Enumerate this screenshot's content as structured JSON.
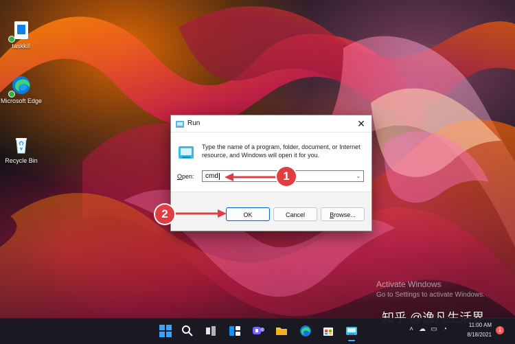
{
  "desktop": {
    "icons": [
      {
        "label": "taskkill"
      },
      {
        "label": "Microsoft Edge"
      },
      {
        "label": "Recycle Bin"
      }
    ]
  },
  "run_dialog": {
    "title": "Run",
    "description": "Type the name of a program, folder, document, or Internet resource, and Windows will open it for you.",
    "open_label_prefix": "O",
    "open_label_suffix": "pen:",
    "input_value": "cmd",
    "buttons": {
      "ok": "OK",
      "cancel": "Cancel",
      "browse_prefix": "B",
      "browse_suffix": "rowse..."
    }
  },
  "annotations": {
    "first": "1",
    "second": "2"
  },
  "activation_notice": {
    "title": "Activate Windows",
    "subtitle": "Go to Settings to activate Windows."
  },
  "watermark": {
    "text": "知乎 @逸凡生活界"
  },
  "taskbar": {
    "time": "11:00 AM",
    "date": "8/18/2021",
    "notifications": "1"
  },
  "colors": {
    "accent": "#0a64c8",
    "annotation": "#e03e42",
    "taskbar": "#1a1a22"
  }
}
